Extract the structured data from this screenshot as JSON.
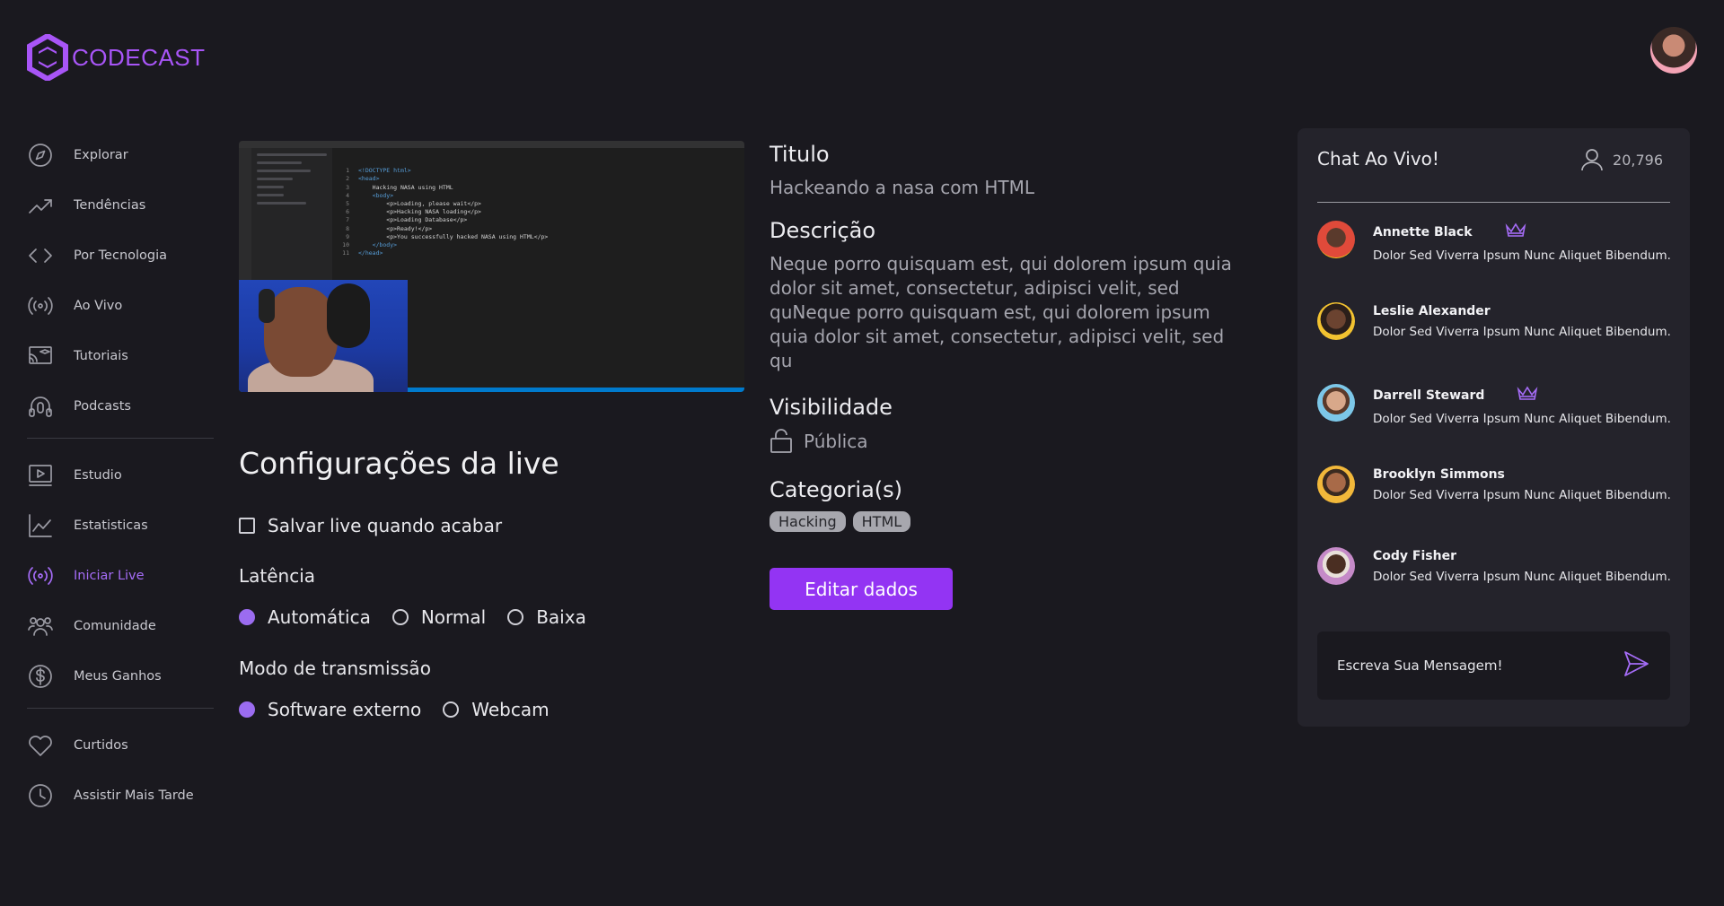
{
  "app": {
    "logo_text": "CODECAST",
    "accent": "#a855f7",
    "button_color": "#9334f3"
  },
  "sidebar": {
    "group1": [
      {
        "label": "Explorar",
        "icon": "compass-icon"
      },
      {
        "label": "Tendências",
        "icon": "trending-icon"
      },
      {
        "label": "Por Tecnologia",
        "icon": "code-icon"
      },
      {
        "label": "Ao Vivo",
        "icon": "broadcast-icon"
      },
      {
        "label": "Tutoriais",
        "icon": "tutorial-icon"
      },
      {
        "label": "Podcasts",
        "icon": "podcast-icon"
      }
    ],
    "group2": [
      {
        "label": "Estudio",
        "icon": "studio-icon"
      },
      {
        "label": "Estatisticas",
        "icon": "chart-icon"
      },
      {
        "label": "Iniciar Live",
        "icon": "live-icon",
        "active": true
      },
      {
        "label": "Comunidade",
        "icon": "community-icon"
      },
      {
        "label": "Meus Ganhos",
        "icon": "dollar-icon"
      }
    ],
    "group3": [
      {
        "label": "Curtidos",
        "icon": "heart-icon"
      },
      {
        "label": "Assistir Mais Tarde",
        "icon": "clock-icon"
      }
    ]
  },
  "video": {
    "code_lines": [
      "<!DOCTYPE html>",
      "<head>",
      "    Hacking NASA using HTML",
      "    <body>",
      "        <p>Loading, please wait</p>",
      "        <p>Hacking NASA loading</p>",
      "        <p>Loading Database</p>",
      "        <p>Ready!</p>",
      "        <p>You successfully hacked NASA using HTML</p>",
      "    </body>",
      "</head>"
    ]
  },
  "settings": {
    "title": "Configurações da live",
    "save_live_label": "Salvar live quando acabar",
    "latency_label": "Latência",
    "latency_options": [
      "Automática",
      "Normal",
      "Baixa"
    ],
    "latency_selected": 0,
    "mode_label": "Modo de transmissão",
    "mode_options": [
      "Software externo",
      "Webcam"
    ],
    "mode_selected": 0
  },
  "details": {
    "title_label": "Titulo",
    "title_value": "Hackeando a nasa com HTML",
    "description_label": "Descrição",
    "description_value": "Neque porro quisquam est, qui dolorem ipsum quia dolor sit amet, consectetur, adipisci velit, sed quNeque porro quisquam est, qui dolorem ipsum quia dolor sit amet, consectetur, adipisci velit, sed qu",
    "visibility_label": "Visibilidade",
    "visibility_value": "Pública",
    "categories_label": "Categoria(s)",
    "categories": [
      "Hacking",
      "HTML"
    ],
    "edit_button": "Editar dados"
  },
  "chat": {
    "title": "Chat Ao Vivo!",
    "viewers": "20,796",
    "messages": [
      {
        "name": "Annette Black",
        "text": "Dolor Sed Viverra Ipsum Nunc Aliquet Bibendum.",
        "crown": true,
        "color": "#e04a3a"
      },
      {
        "name": "Leslie Alexander",
        "text": "Dolor Sed Viverra Ipsum Nunc Aliquet Bibendum.",
        "crown": false,
        "color": "#f2c230"
      },
      {
        "name": "Darrell Steward",
        "text": "Dolor Sed Viverra Ipsum Nunc Aliquet Bibendum.",
        "crown": true,
        "color": "#7cc7e8"
      },
      {
        "name": "Brooklyn Simmons",
        "text": "Dolor Sed Viverra Ipsum Nunc Aliquet Bibendum.",
        "crown": false,
        "color": "#f2b83a"
      },
      {
        "name": "Cody Fisher",
        "text": "Dolor Sed Viverra Ipsum Nunc Aliquet Bibendum.",
        "crown": false,
        "color": "#c58ac8"
      }
    ],
    "input_placeholder": "Escreva Sua Mensagem!"
  }
}
